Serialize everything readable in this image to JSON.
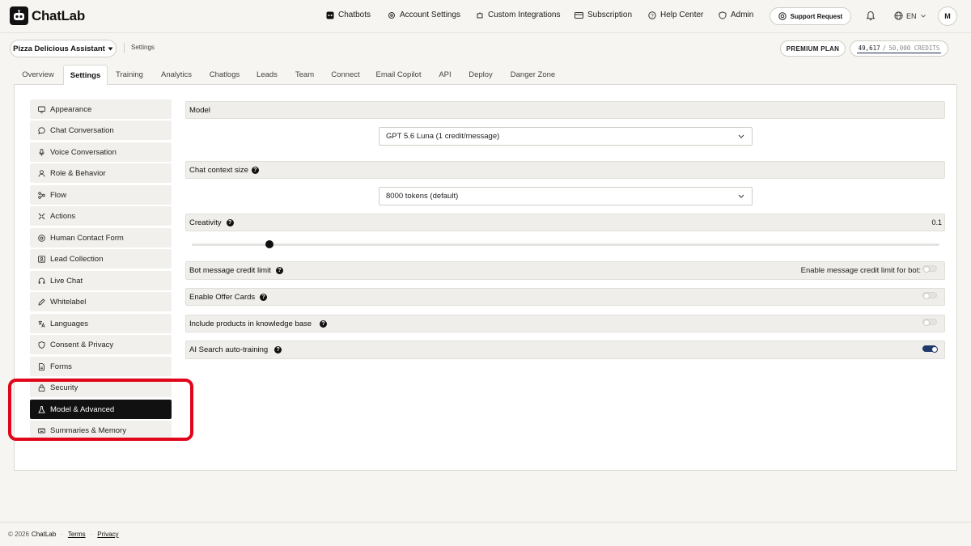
{
  "app": {
    "name": "ChatLab"
  },
  "nav": [
    {
      "label": "Chatbots",
      "icon": "bot-icon"
    },
    {
      "label": "Account Settings",
      "icon": "gear-icon"
    },
    {
      "label": "Custom Integrations",
      "icon": "puzzle-icon"
    },
    {
      "label": "Subscription",
      "icon": "card-icon"
    },
    {
      "label": "Help Center",
      "icon": "help-icon"
    },
    {
      "label": "Admin",
      "icon": "shield-icon"
    }
  ],
  "header": {
    "support_label": "Support Request",
    "lang": "EN",
    "avatar_initial": "M"
  },
  "subheader": {
    "bot_name": "Pizza Delicious Assistant",
    "breadcrumb": "Settings",
    "plan": "PREMIUM PLAN",
    "credits_used": "49,617",
    "credits_sep": "/",
    "credits_total": "50,000 CREDITS"
  },
  "tabs": [
    {
      "label": "Overview"
    },
    {
      "label": "Settings"
    },
    {
      "label": "Training"
    },
    {
      "label": "Analytics"
    },
    {
      "label": "Chatlogs"
    },
    {
      "label": "Leads"
    },
    {
      "label": "Team"
    },
    {
      "label": "Connect"
    },
    {
      "label": "Email Copilot"
    },
    {
      "label": "API"
    },
    {
      "label": "Deploy"
    },
    {
      "label": "Danger Zone"
    }
  ],
  "sidebar": [
    {
      "label": "Appearance",
      "icon": "monitor-icon"
    },
    {
      "label": "Chat Conversation",
      "icon": "chat-bubble-icon"
    },
    {
      "label": "Voice Conversation",
      "icon": "microphone-icon"
    },
    {
      "label": "Role & Behavior",
      "icon": "person-icon"
    },
    {
      "label": "Flow",
      "icon": "flow-icon"
    },
    {
      "label": "Actions",
      "icon": "actions-icon"
    },
    {
      "label": "Human Contact Form",
      "icon": "at-sign-icon"
    },
    {
      "label": "Lead Collection",
      "icon": "contact-card-icon"
    },
    {
      "label": "Live Chat",
      "icon": "headset-icon"
    },
    {
      "label": "Whitelabel",
      "icon": "pen-icon"
    },
    {
      "label": "Languages",
      "icon": "translate-icon"
    },
    {
      "label": "Consent & Privacy",
      "icon": "shield-icon"
    },
    {
      "label": "Forms",
      "icon": "document-icon"
    },
    {
      "label": "Security",
      "icon": "lock-icon"
    },
    {
      "label": "Model & Advanced",
      "icon": "flask-icon"
    },
    {
      "label": "Summaries & Memory",
      "icon": "keyboard-icon"
    }
  ],
  "settings": {
    "model_label": "Model",
    "model_value": "GPT 5.6 Luna (1 credit/message)",
    "context_label": "Chat context size",
    "context_value": "8000 tokens (default)",
    "creativity_label": "Creativity",
    "creativity_value": "0.1",
    "creativity_level": 0.1,
    "credit_limit_label": "Bot message credit limit",
    "credit_limit_toggle_label": "Enable message credit limit for bot:",
    "credit_limit_enabled": false,
    "offer_cards_label": "Enable Offer Cards",
    "offer_cards_enabled": false,
    "include_products_label": "Include products in knowledge base",
    "include_products_enabled": false,
    "ai_search_label": "AI Search auto-training",
    "ai_search_enabled": true
  },
  "footer": {
    "copyright": "© 2026",
    "brand": "ChatLab",
    "terms": "Terms",
    "privacy": "Privacy"
  },
  "colors": {
    "accent": "#111111",
    "toggle_on": "#1f3a6b",
    "highlight": "#e1051a",
    "background": "#f6f5f1"
  }
}
